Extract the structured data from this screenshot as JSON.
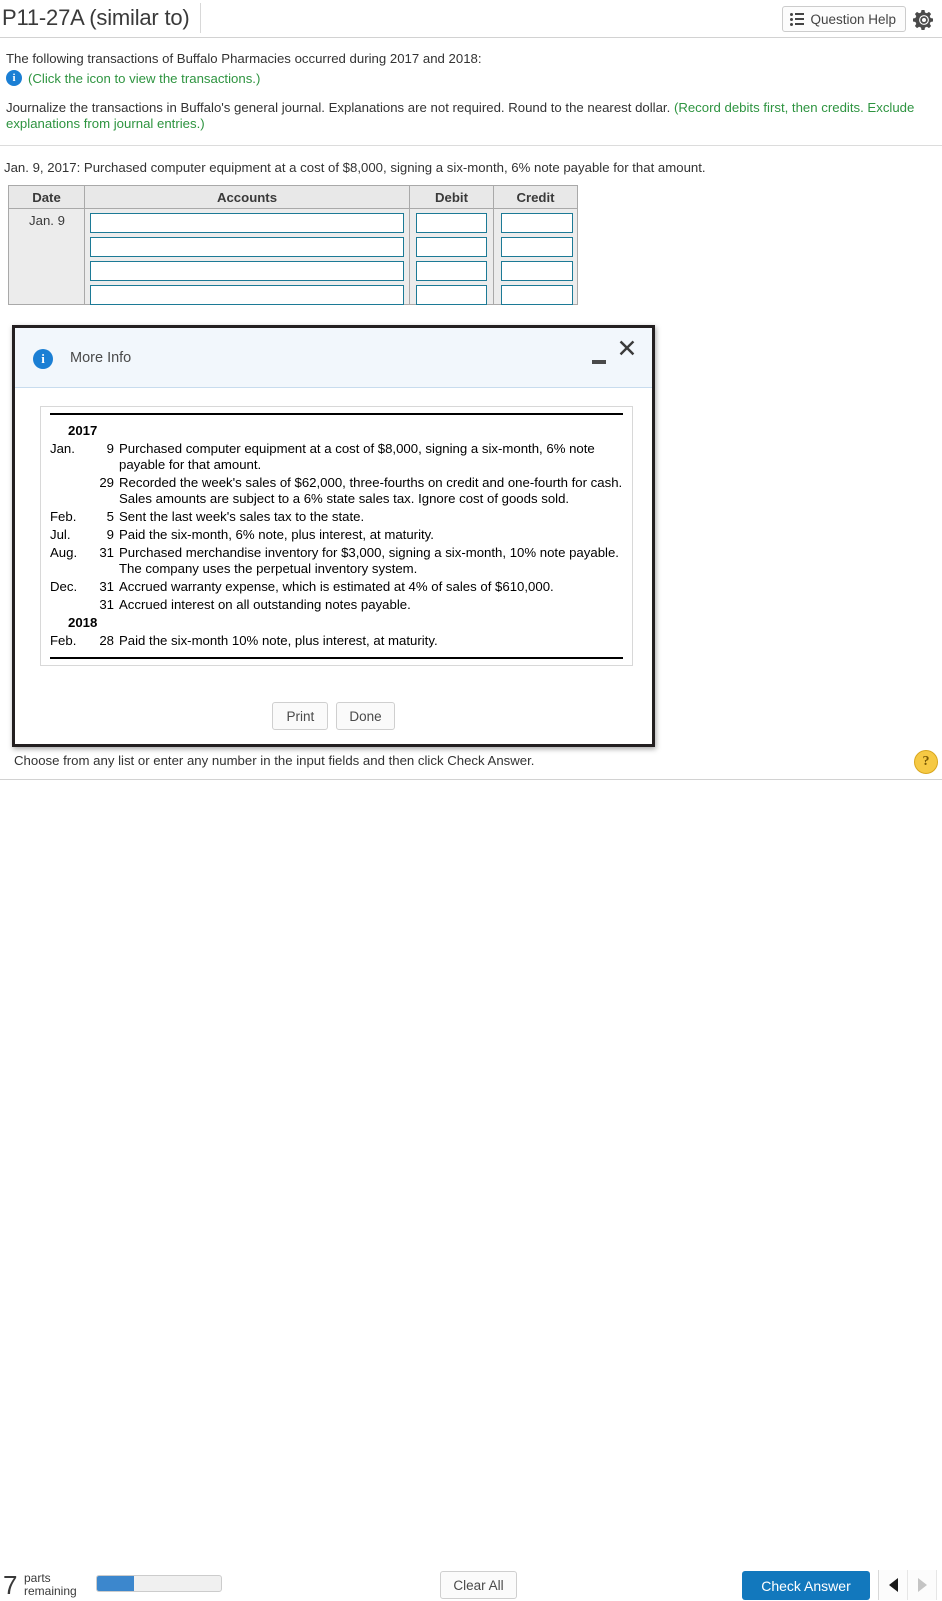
{
  "topbar": {
    "title": "P11-27A (similar to)",
    "question_help_label": "Question Help",
    "question_help_icon": "list-icon",
    "gear_icon": "gear-icon"
  },
  "question": {
    "intro": "The following transactions of Buffalo Pharmacies occurred during 2017 and 2018:",
    "info_icon": "info-icon",
    "info_link": "(Click the icon to view the transactions.)",
    "requirement_black": "Journalize the transactions in Buffalo's general journal. Explanations are not required. Round to the nearest dollar. ",
    "requirement_green": "(Record debits first, then credits. Exclude explanations from journal entries.)",
    "green_color": "#2e9440"
  },
  "journal": {
    "prompt": "Jan. 9, 2017: Purchased computer equipment at a cost of $8,000, signing a six-month, 6% note payable for that amount.",
    "headers": [
      "Date",
      "Accounts",
      "Debit",
      "Credit"
    ],
    "date_value": "Jan. 9",
    "rows": 4,
    "input_value": "",
    "input_border_color": "#1c7a96"
  },
  "modal": {
    "icon": "info-icon",
    "title": "More Info",
    "minimize_icon": "minimize-icon",
    "close_icon": "close-icon",
    "transactions": [
      {
        "kind": "year",
        "text": "2017"
      },
      {
        "kind": "entry",
        "month": "Jan.",
        "day": "9",
        "desc": "Purchased computer equipment at a cost of $8,000, signing a six-month, 6% note payable for that amount."
      },
      {
        "kind": "entry",
        "month": "",
        "day": "29",
        "desc": "Recorded the week's sales of $62,000, three-fourths on credit and one-fourth for cash. Sales amounts are subject to a 6% state sales tax. Ignore cost of goods sold."
      },
      {
        "kind": "entry",
        "month": "Feb.",
        "day": "5",
        "desc": "Sent the last week's sales tax to the state."
      },
      {
        "kind": "entry",
        "month": "Jul.",
        "day": "9",
        "desc": "Paid the six-month, 6% note, plus interest, at maturity."
      },
      {
        "kind": "entry",
        "month": "Aug.",
        "day": "31",
        "desc": "Purchased merchandise inventory for $3,000, signing a six-month, 10% note payable. The company uses the perpetual inventory system."
      },
      {
        "kind": "entry",
        "month": "Dec.",
        "day": "31",
        "desc": "Accrued warranty expense, which is estimated at 4% of sales of $610,000."
      },
      {
        "kind": "entry",
        "month": "",
        "day": "31",
        "desc": "Accrued interest on all outstanding notes payable."
      },
      {
        "kind": "year",
        "text": "2018"
      },
      {
        "kind": "entry",
        "month": "Feb.",
        "day": "28",
        "desc": "Paid the six-month 10% note, plus interest, at maturity."
      }
    ],
    "print_label": "Print",
    "done_label": "Done"
  },
  "footer": {
    "hint": "Choose from any list or enter any number in the input fields and then click Check Answer.",
    "help_icon": "question-mark-icon",
    "parts_number": "7",
    "parts_label_line1": "parts",
    "parts_label_line2": "remaining",
    "progress_percent": 30,
    "progress_fill_color": "#3c87cd",
    "clear_all_label": "Clear All",
    "check_answer_label": "Check Answer",
    "check_answer_color": "#1278bd",
    "prev_icon": "triangle-left-icon",
    "next_icon": "triangle-right-icon"
  }
}
